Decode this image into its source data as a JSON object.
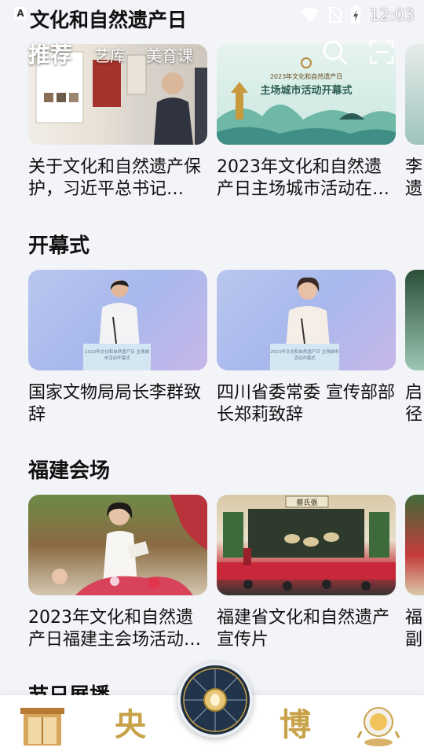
{
  "status_bar": {
    "app_icon_letter": "A",
    "time": "12:03"
  },
  "header": {
    "title": "文化和自然遗产日"
  },
  "tabs": [
    {
      "label": "推荐",
      "active": true
    },
    {
      "label": "艺库",
      "active": false
    },
    {
      "label": "美育课",
      "active": false
    }
  ],
  "sections": [
    {
      "title": "",
      "cards": [
        {
          "caption": "关于文化和自然遗产保护，习近平总书记…"
        },
        {
          "caption": "2023年文化和自然遗产日主场城市活动在…",
          "thumb_text": {
            "line1": "2023年文化和自然遗产日",
            "line2": "主场城市活动开幕式"
          }
        },
        {
          "caption": "李遗"
        }
      ]
    },
    {
      "title": "开幕式",
      "cards": [
        {
          "caption": "国家文物局局长李群致辞",
          "podium_text": "2023年文化和自然遗产日 主场城市活动开幕式"
        },
        {
          "caption": "四川省委常委 宣传部部长郑莉致辞",
          "podium_text": "2023年文化和自然遗产日 主场城市活动开幕式"
        },
        {
          "caption": "启径"
        }
      ]
    },
    {
      "title": "福建会场",
      "cards": [
        {
          "caption": "2023年文化和自然遗产日福建主会场活动…"
        },
        {
          "caption": "福建省文化和自然遗产宣传片",
          "thumb_text": {
            "sign": "蔡氏張"
          }
        },
        {
          "caption": "福副"
        }
      ]
    },
    {
      "title": "节日展播",
      "cards": []
    }
  ],
  "bottom_nav": [
    {
      "icon": "gate-icon",
      "label": ""
    },
    {
      "icon": "yang-icon",
      "label": "央"
    },
    {
      "icon": "compass-icon",
      "label": ""
    },
    {
      "icon": "bo-icon",
      "label": "博"
    },
    {
      "icon": "astronaut-icon",
      "label": ""
    }
  ],
  "colors": {
    "background": "#f3f4f8",
    "accent_gold": "#c8a24a",
    "text": "#111111"
  }
}
